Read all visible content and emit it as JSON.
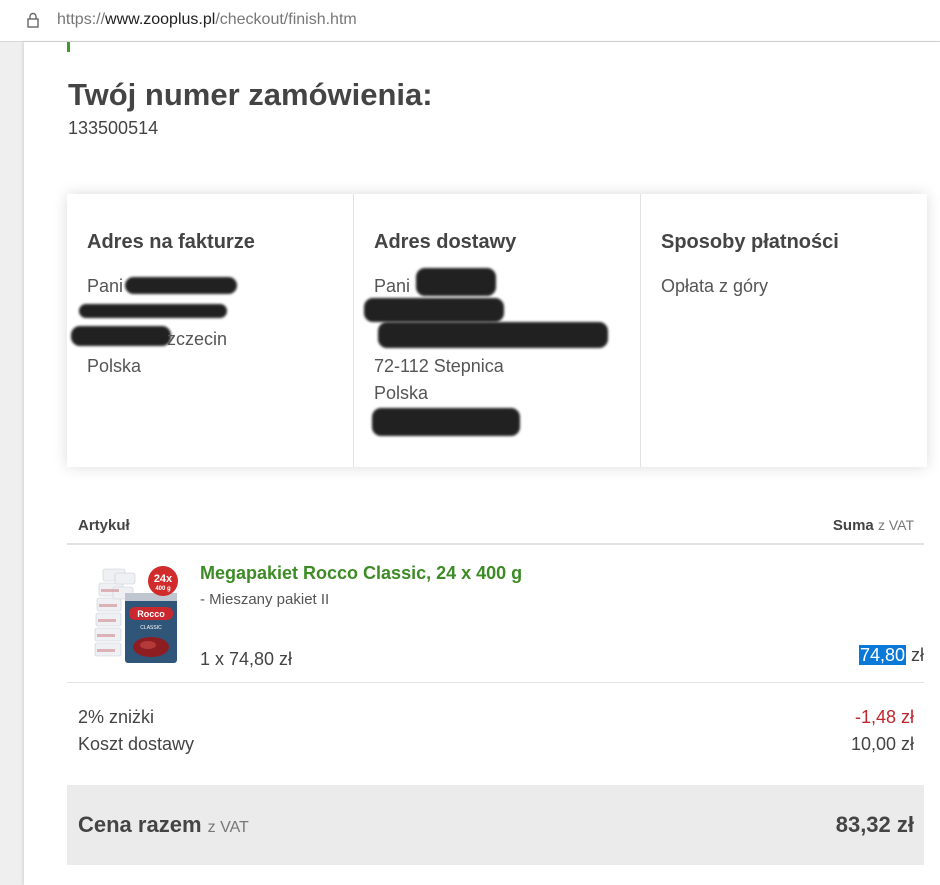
{
  "browser": {
    "url_scheme": "https://",
    "url_host": "www.zooplus.pl",
    "url_path": "/checkout/finish.htm"
  },
  "order": {
    "title": "Twój numer zamówienia:",
    "number": "133500514"
  },
  "billing": {
    "heading": "Adres na fakturze",
    "salutation": "Pani",
    "city_partial": "zczecin",
    "country": "Polska"
  },
  "shipping": {
    "heading": "Adres dostawy",
    "salutation": "Pani",
    "postal_city": "72-112 Stepnica",
    "country": "Polska"
  },
  "payment": {
    "heading": "Sposoby płatności",
    "method": "Opłata z góry"
  },
  "table": {
    "col_item": "Artykuł",
    "col_sum": "Suma",
    "col_sum_suffix": "z VAT"
  },
  "product": {
    "name": "Megapakiet Rocco Classic, 24 x 400 g",
    "variant": "- Mieszany pakiet II",
    "quantity_line": "1 x 74,80 zł",
    "price_value": "74,80",
    "price_currency": "zł",
    "badge_count": "24x",
    "badge_weight": "400 g",
    "can_brand": "Rocco",
    "can_label": "CLASSIC",
    "image_icon": "product-can-image"
  },
  "summary": {
    "discount_label": "2% zniżki",
    "discount_value": "-1,48 zł",
    "shipping_label": "Koszt dostawy",
    "shipping_value": "10,00 zł"
  },
  "total": {
    "label": "Cena razem",
    "label_suffix": "z VAT",
    "value": "83,32 zł"
  },
  "colors": {
    "brand_green": "#3d8b25",
    "negative_red": "#c0262d",
    "selection_blue": "#0a78d7"
  }
}
